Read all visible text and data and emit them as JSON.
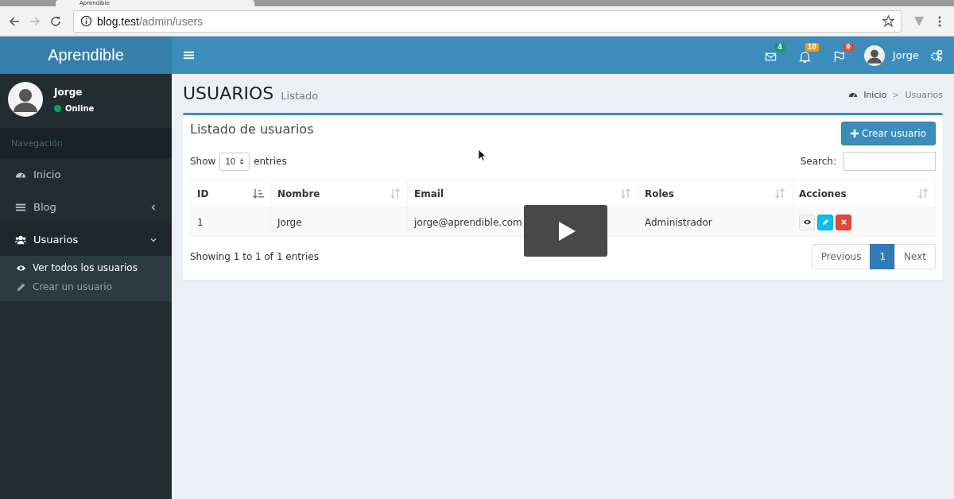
{
  "browser": {
    "tab_title": "Aprendible",
    "url_host": "blog.test",
    "url_path": "/admin/users"
  },
  "header": {
    "logo": "Aprendible",
    "notifications": [
      {
        "kind": "mail",
        "count": "4",
        "color": "#00a65a"
      },
      {
        "kind": "bell",
        "count": "10",
        "color": "#f39c12"
      },
      {
        "kind": "flag",
        "count": "9",
        "color": "#dd4b39"
      }
    ],
    "user": "Jorge"
  },
  "sidebar": {
    "user": "Jorge",
    "status": "Online",
    "section": "Navegación",
    "items": [
      {
        "label": "Inicio",
        "selected": false
      },
      {
        "label": "Blog",
        "selected": false,
        "expanded": false
      },
      {
        "label": "Usuarios",
        "selected": true,
        "expanded": true,
        "children": [
          {
            "label": "Ver todos los usuarios",
            "selected": true
          },
          {
            "label": "Crear un usuario",
            "selected": false
          }
        ]
      }
    ]
  },
  "page": {
    "title": "USUARIOS",
    "subtitle": "Listado",
    "breadcrumb": [
      "Inicio",
      "Usuarios"
    ],
    "breadcrumb_separator": ">"
  },
  "box": {
    "title": "Listado de usuarios",
    "create_button": "Crear usuario",
    "show_label": "Show",
    "page_size": "10",
    "entries_label": "entries",
    "search_label": "Search:",
    "columns": [
      {
        "label": "ID",
        "sorted": true
      },
      {
        "label": "Nombre",
        "sorted": false
      },
      {
        "label": "Email",
        "sorted": false
      },
      {
        "label": "Roles",
        "sorted": false
      },
      {
        "label": "Acciones",
        "sorted": false
      }
    ],
    "rows": [
      {
        "cells": [
          "1",
          "Jorge",
          "jorge@aprendible.com",
          "Administrador"
        ],
        "actions": [
          {
            "kind": "view"
          },
          {
            "kind": "edit"
          },
          {
            "kind": "delete"
          }
        ]
      }
    ],
    "info": "Showing 1 to 1 of 1 entries",
    "pagination": [
      {
        "label": "Previous",
        "selected": false
      },
      {
        "label": "1",
        "selected": true
      },
      {
        "label": "Next",
        "selected": false
      }
    ]
  }
}
